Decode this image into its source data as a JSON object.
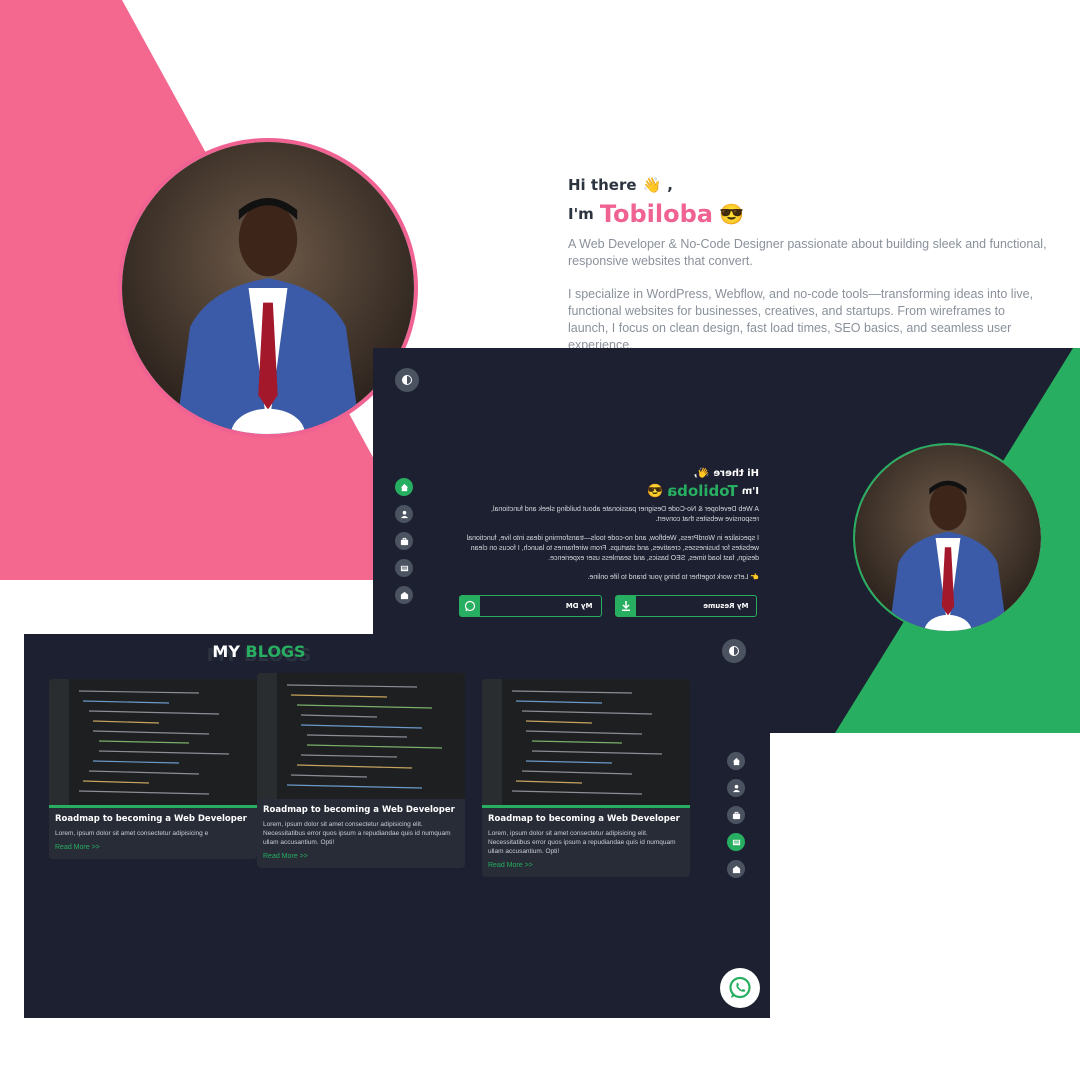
{
  "colors": {
    "pink": "#f06292",
    "green": "#27ae60",
    "dark_bg": "#1c2030",
    "card_bg": "#272c37"
  },
  "light": {
    "greeting": "Hi there",
    "wave_emoji": "👋",
    "comma": ",",
    "im": "I'm",
    "name": "Tobiloba",
    "cool_emoji": "😎",
    "tagline": "A Web Developer & No-Code Designer passionate about building sleek and functional, responsive websites that convert.",
    "about": "I specialize in WordPress, Webflow, and no-code tools—transforming ideas into live, functional websites for businesses, creatives, and startups. From wireframes to launch, I focus on clean design, fast load times, SEO basics, and seamless user experience."
  },
  "dark": {
    "greeting": "Hi there 👋,",
    "im": "I'm",
    "name": "Tobiloba",
    "cool_emoji": "😎",
    "tagline": "A Web Developer & No-Code Designer passionate about building sleek and functional, responsive websites that convert.",
    "about": "I specialize in WordPress, Webflow, and no-code tools—transforming ideas into live, functional websites for businesses, creatives, and startups. From wireframes to launch, I focus on clean design, fast load times, SEO basics, and seamless user experience.",
    "cta": "👉 Let's work together to bring your brand to life online.",
    "resume_label": "My Resume",
    "dm_label": "My DM",
    "nav_icons": [
      "home-icon",
      "user-icon",
      "briefcase-icon",
      "blog-icon",
      "contact-icon"
    ]
  },
  "blogs": {
    "title_white": "MY",
    "title_green": "BLOGS",
    "shadow_text": "MY BLOGS",
    "cards": [
      {
        "title": "Roadmap to becoming a Web Developer",
        "excerpt": "Lorem, ipsum dolor sit amet consectetur adipisicing e",
        "more": "Read More >>"
      },
      {
        "title": "Roadmap to becoming a Web Developer",
        "excerpt": "Lorem, ipsum dolor sit amet consectetur adipisicing elit. Necessitatibus error quos ipsum a repudiandae quis id numquam ullam accusantium. Opti!",
        "more": "Read More >>"
      },
      {
        "title": "Roadmap to becoming a Web Developer",
        "excerpt": "Lorem, ipsum dolor sit amet consectetur adipisicing elit. Necessitatibus error quos ipsum a repudiandae quis id numquam ullam accusantium. Opti!",
        "more": "Read More >>"
      }
    ],
    "nav_icons": [
      "home-icon",
      "user-icon",
      "briefcase-icon",
      "blog-icon",
      "contact-icon"
    ],
    "active_nav": 3
  }
}
